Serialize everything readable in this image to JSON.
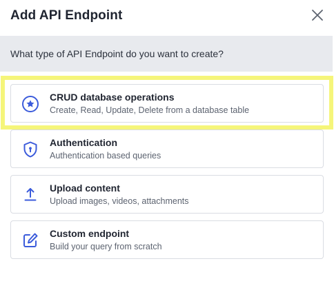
{
  "dialog": {
    "title": "Add API Endpoint",
    "question": "What type of API Endpoint do you want to create?"
  },
  "options": [
    {
      "label": "CRUD database operations",
      "description": "Create, Read, Update, Delete from a database table",
      "icon": "star-circle-icon"
    },
    {
      "label": "Authentication",
      "description": "Authentication based queries",
      "icon": "shield-icon"
    },
    {
      "label": "Upload content",
      "description": "Upload images, videos, attachments",
      "icon": "upload-icon"
    },
    {
      "label": "Custom endpoint",
      "description": "Build your query from scratch",
      "icon": "edit-icon"
    }
  ],
  "colors": {
    "accent": "#3b5bdb",
    "highlight": "#f5f57a",
    "header_band": "#e8eaee"
  }
}
